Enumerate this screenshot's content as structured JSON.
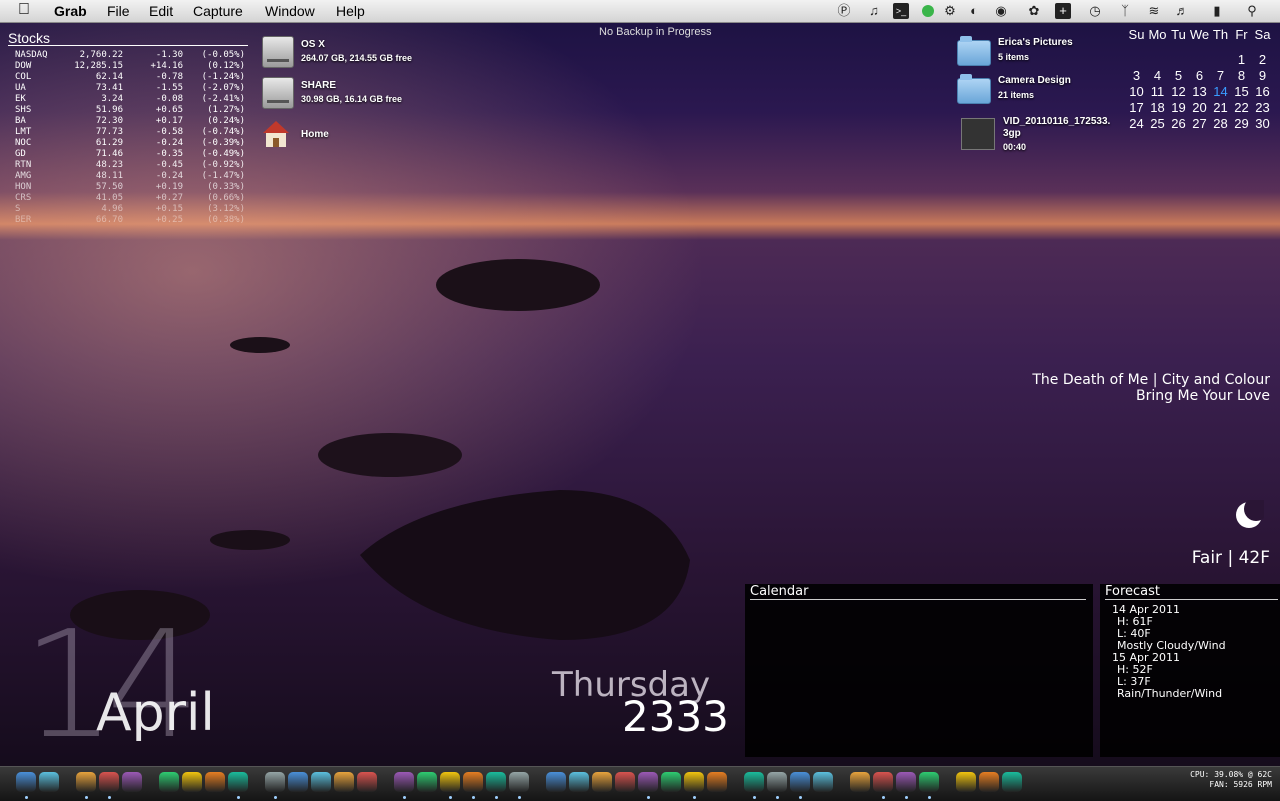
{
  "menubar": {
    "app_name": "Grab",
    "items": [
      "File",
      "Edit",
      "Capture",
      "Window",
      "Help"
    ],
    "status_icons": [
      "quicksilver-icon",
      "headphones-icon",
      "terminal-icon",
      "green-status-icon",
      "gear-icon",
      "time-machine-icon",
      "eye-icon",
      "paw-icon",
      "plus-icon",
      "clock-icon",
      "bluetooth-icon",
      "wifi-icon",
      "volume-icon",
      "battery-icon",
      "search-icon"
    ]
  },
  "backup_status": "No Backup in Progress",
  "stocks": {
    "title": "Stocks",
    "rows": [
      {
        "sym": "NASDAQ",
        "price": "2,760.22",
        "chg": "-1.30",
        "pct": "(-0.05%)"
      },
      {
        "sym": "DOW",
        "price": "12,285.15",
        "chg": "+14.16",
        "pct": "(0.12%)"
      },
      {
        "sym": "COL",
        "price": "62.14",
        "chg": "-0.78",
        "pct": "(-1.24%)"
      },
      {
        "sym": "UA",
        "price": "73.41",
        "chg": "-1.55",
        "pct": "(-2.07%)"
      },
      {
        "sym": "EK",
        "price": "3.24",
        "chg": "-0.08",
        "pct": "(-2.41%)"
      },
      {
        "sym": "SHS",
        "price": "51.96",
        "chg": "+0.65",
        "pct": "(1.27%)"
      },
      {
        "sym": "BA",
        "price": "72.30",
        "chg": "+0.17",
        "pct": "(0.24%)"
      },
      {
        "sym": "LMT",
        "price": "77.73",
        "chg": "-0.58",
        "pct": "(-0.74%)"
      },
      {
        "sym": "NOC",
        "price": "61.29",
        "chg": "-0.24",
        "pct": "(-0.39%)"
      },
      {
        "sym": "GD",
        "price": "71.46",
        "chg": "-0.35",
        "pct": "(-0.49%)"
      },
      {
        "sym": "RTN",
        "price": "48.23",
        "chg": "-0.45",
        "pct": "(-0.92%)"
      },
      {
        "sym": "AMG",
        "price": "48.11",
        "chg": "-0.24",
        "pct": "(-1.47%)"
      },
      {
        "sym": "HON",
        "price": "57.50",
        "chg": "+0.19",
        "pct": "(0.33%)"
      },
      {
        "sym": "CRS",
        "price": "41.05",
        "chg": "+0.27",
        "pct": "(0.66%)"
      },
      {
        "sym": "S",
        "price": "4.96",
        "chg": "+0.15",
        "pct": "(3.12%)"
      },
      {
        "sym": "BER",
        "price": "66.70",
        "chg": "+0.25",
        "pct": "(0.38%)"
      }
    ]
  },
  "desktop": {
    "drives": [
      {
        "name": "OS X",
        "info": "264.07 GB, 214.55 GB free"
      },
      {
        "name": "SHARE",
        "info": "30.98 GB, 16.14 GB free"
      }
    ],
    "home": "Home",
    "folders": [
      {
        "name": "Erica's Pictures",
        "info": "5 items"
      },
      {
        "name": "Camera Design",
        "info": "21 items"
      }
    ],
    "video": {
      "name_line1": "VID_20110116_172533.",
      "name_line2": "3gp",
      "info": "00:40"
    }
  },
  "mini_calendar": {
    "headers": [
      "Su",
      "Mo",
      "Tu",
      "We",
      "Th",
      "Fr",
      "Sa"
    ],
    "weeks": [
      [
        "",
        "",
        "",
        "",
        "",
        "1",
        "2"
      ],
      [
        "3",
        "4",
        "5",
        "6",
        "7",
        "8",
        "9"
      ],
      [
        "10",
        "11",
        "12",
        "13",
        "14",
        "15",
        "16"
      ],
      [
        "17",
        "18",
        "19",
        "20",
        "21",
        "22",
        "23"
      ],
      [
        "24",
        "25",
        "26",
        "27",
        "28",
        "29",
        "30"
      ]
    ],
    "today": "14"
  },
  "now_playing": {
    "line1": "The Death of Me | City and Colour",
    "line2": "Bring Me Your Love"
  },
  "weather": {
    "icon": "moon-icon",
    "text": "Fair | 42F"
  },
  "calendar_panel": {
    "title": "Calendar"
  },
  "forecast": {
    "title": "Forecast",
    "lines": [
      "14 Apr 2011",
      "H: 61F",
      "L: 40F",
      "Mostly Cloudy/Wind",
      "15 Apr 2011",
      "H: 52F",
      "L: 37F",
      "Rain/Thunder/Wind"
    ]
  },
  "date_big": {
    "day": "14",
    "month": "April"
  },
  "weekday": {
    "day": "Thursday",
    "time": "2333"
  },
  "system_stats": {
    "cpu": "CPU: 39.08% @ 62C",
    "fan": "FAN: 5926 RPM"
  },
  "dock_apps": [
    "finder-icon",
    "app-store-icon",
    "chrome-icon",
    "safari-icon",
    "opera-icon",
    "adium-icon",
    "ichat-icon",
    "facetime-icon",
    "skype-icon",
    "itunes-icon",
    "ipod-icon",
    "photo-booth-icon",
    "pineapple-icon",
    "xcode-icon",
    "preview-icon",
    "pen-tool-icon",
    "photo-icon",
    "mail-icon",
    "cross-icon",
    "ical-icon",
    "notes-icon",
    "iphoto-icon",
    "scanner-icon",
    "upload-icon",
    "flipboard-icon",
    "pdf-icon",
    "dvd-icon",
    "star-icon",
    "adium-duck-icon",
    "x11-icon",
    "terminal-icon",
    "network-icon",
    "system-icon",
    "disk-icon",
    "time-icon",
    "utility-icon",
    "documents-folder-icon",
    "file-icon",
    "trash-icon"
  ],
  "colors": {
    "today_accent": "#3a9cff",
    "dock_indicator": "#9fd0ff"
  }
}
